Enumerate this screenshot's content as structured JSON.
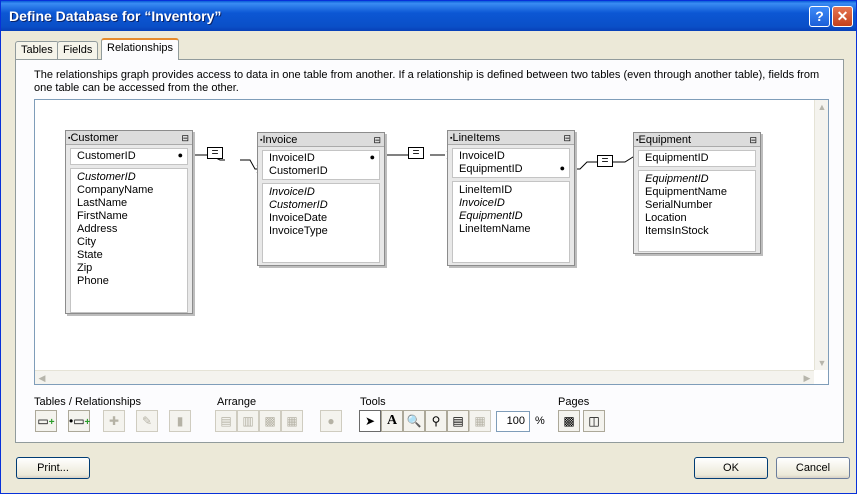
{
  "window": {
    "title": "Define Database for “Inventory”",
    "help_label": "?",
    "close_label": "✕"
  },
  "tabs": [
    {
      "label": "Tables"
    },
    {
      "label": "Fields"
    },
    {
      "label": "Relationships"
    }
  ],
  "description": "The relationships graph provides access to data in one table from another. If a relationship is defined between two tables (even through another table), fields from one table can be accessed from the other.",
  "graph": {
    "tables": [
      {
        "name": "Customer",
        "keys": [
          "CustomerID"
        ],
        "fields": [
          "CustomerID",
          "CompanyName",
          "LastName",
          "FirstName",
          "Address",
          "City",
          "State",
          "Zip",
          "Phone"
        ]
      },
      {
        "name": "Invoice",
        "keys": [
          "InvoiceID",
          "CustomerID"
        ],
        "fields": [
          "InvoiceID",
          "CustomerID",
          "InvoiceDate",
          "InvoiceType"
        ]
      },
      {
        "name": "LineItems",
        "keys": [
          "InvoiceID",
          "EquipmentID"
        ],
        "fields": [
          "LineItemID",
          "InvoiceID",
          "EquipmentID",
          "LineItemName"
        ]
      },
      {
        "name": "Equipment",
        "keys": [
          "EquipmentID"
        ],
        "fields": [
          "EquipmentID",
          "EquipmentName",
          "SerialNumber",
          "Location",
          "ItemsInStock"
        ]
      }
    ],
    "relationship_operator": "="
  },
  "toolbar": {
    "sections": [
      "Tables / Relationships",
      "Arrange",
      "Tools",
      "Pages"
    ],
    "zoom": "100",
    "zoom_unit": "%",
    "text_tool_label": "A"
  },
  "buttons": {
    "print": "Print...",
    "ok": "OK",
    "cancel": "Cancel"
  }
}
